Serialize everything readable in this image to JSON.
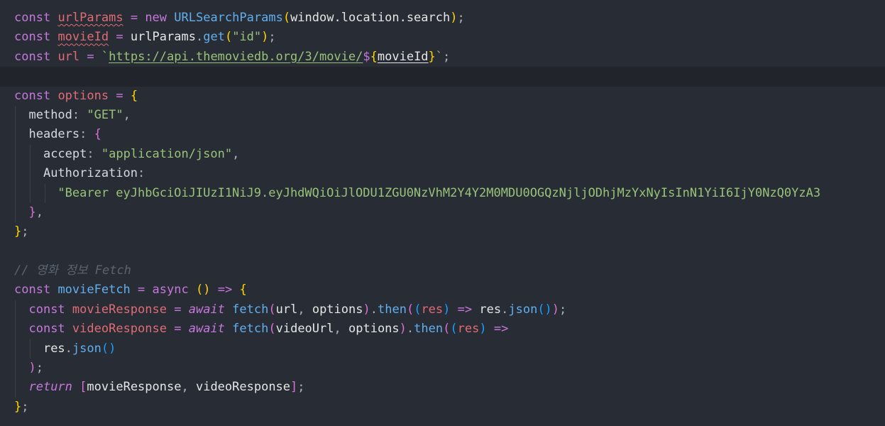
{
  "tokens": {
    "const": "const",
    "new": "new",
    "async": "async",
    "await": "await",
    "return": "return",
    "urlParams": "urlParams",
    "URLSearchParams": "URLSearchParams",
    "window_location_search": "window.location.search",
    "movieId": "movieId",
    "urlParams_ref": "urlParams",
    "get": "get",
    "id_str": "\"id\"",
    "url": "url",
    "url_literal": "https://api.themoviedb.org/3/movie/",
    "options": "options",
    "method": "method",
    "GET": "\"GET\"",
    "headers": "headers",
    "accept": "accept",
    "accept_value": "\"application/json\"",
    "Authorization": "Authorization",
    "bearer_value": "\"Bearer eyJhbGciOiJIUzI1NiJ9.eyJhdWQiOiJlODU1ZGU0NzVhM2Y4Y2M0MDU0OGQzNjljODhjMzYxNyIsInN1YiI6IjY0NzQ0YzA3",
    "comment": "// 영화 정보 Fetch",
    "movieFetch": "movieFetch",
    "movieResponse": "movieResponse",
    "videoResponse": "videoResponse",
    "fetch": "fetch",
    "then": "then",
    "res": "res",
    "json": "json",
    "videoUrl": "videoUrl"
  },
  "colors": {
    "background": "#282c34",
    "current_line": "#21252b",
    "keyword": "#c678dd",
    "variable": "#e06c75",
    "function": "#61afef",
    "string": "#98c379",
    "comment": "#5c6370"
  }
}
